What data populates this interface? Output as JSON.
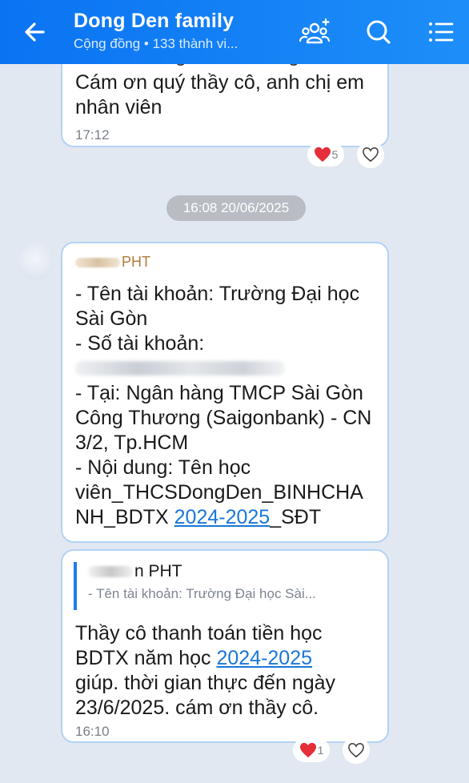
{
  "header": {
    "title": "Dong Den family",
    "subtitle": "Cộng đồng • 133 thành vi..."
  },
  "messages": [
    {
      "text_lines": [
        "đoàn trường THCS Đồng Đen.",
        "Cám ơn quý thầy cô, anh chị em",
        "nhân viên"
      ],
      "time": "17:12",
      "reaction_count": "5"
    },
    {
      "sender_suffix": "PHT",
      "lines": [
        "- Tên tài khoản: Trường Đại học",
        "Sài Gòn",
        "- Số tài khoản:",
        "- Tại: Ngân hàng TMCP Sài Gòn",
        "Công Thương (Saigonbank) - CN",
        "3/2, Tp.HCM",
        "- Nội dung:  Tên học",
        "viên_THCSDongDen_BINHCHA",
        "NH_BDTX "
      ],
      "link_text": "2024-2025",
      "tail_text": "_SĐT"
    },
    {
      "quote_sender_suffix": "n PHT",
      "quote_preview": "- Tên tài khoản: Trường Đại học Sài...",
      "line1": "Thầy cô thanh toán tiền học",
      "line2_prefix": "BDTX năm học ",
      "link_text": "2024-2025",
      "line3": "giúp. thời gian thực đến ngày",
      "line4": "23/6/2025. cám ơn thầy cô.",
      "time": "16:10",
      "reaction_count": "1"
    }
  ],
  "date_separator": "16:08 20/06/2025",
  "icons": {
    "back": "arrow-left-icon",
    "add_member": "add-member-icon",
    "search": "search-icon",
    "menu": "menu-list-icon",
    "heart": "heart-icon",
    "like": "heart-outline-icon"
  },
  "colors": {
    "header": "#1d8cf8",
    "bubble_border": "#b3d3f5",
    "link": "#1977d8",
    "reaction": "#e52e3a"
  }
}
